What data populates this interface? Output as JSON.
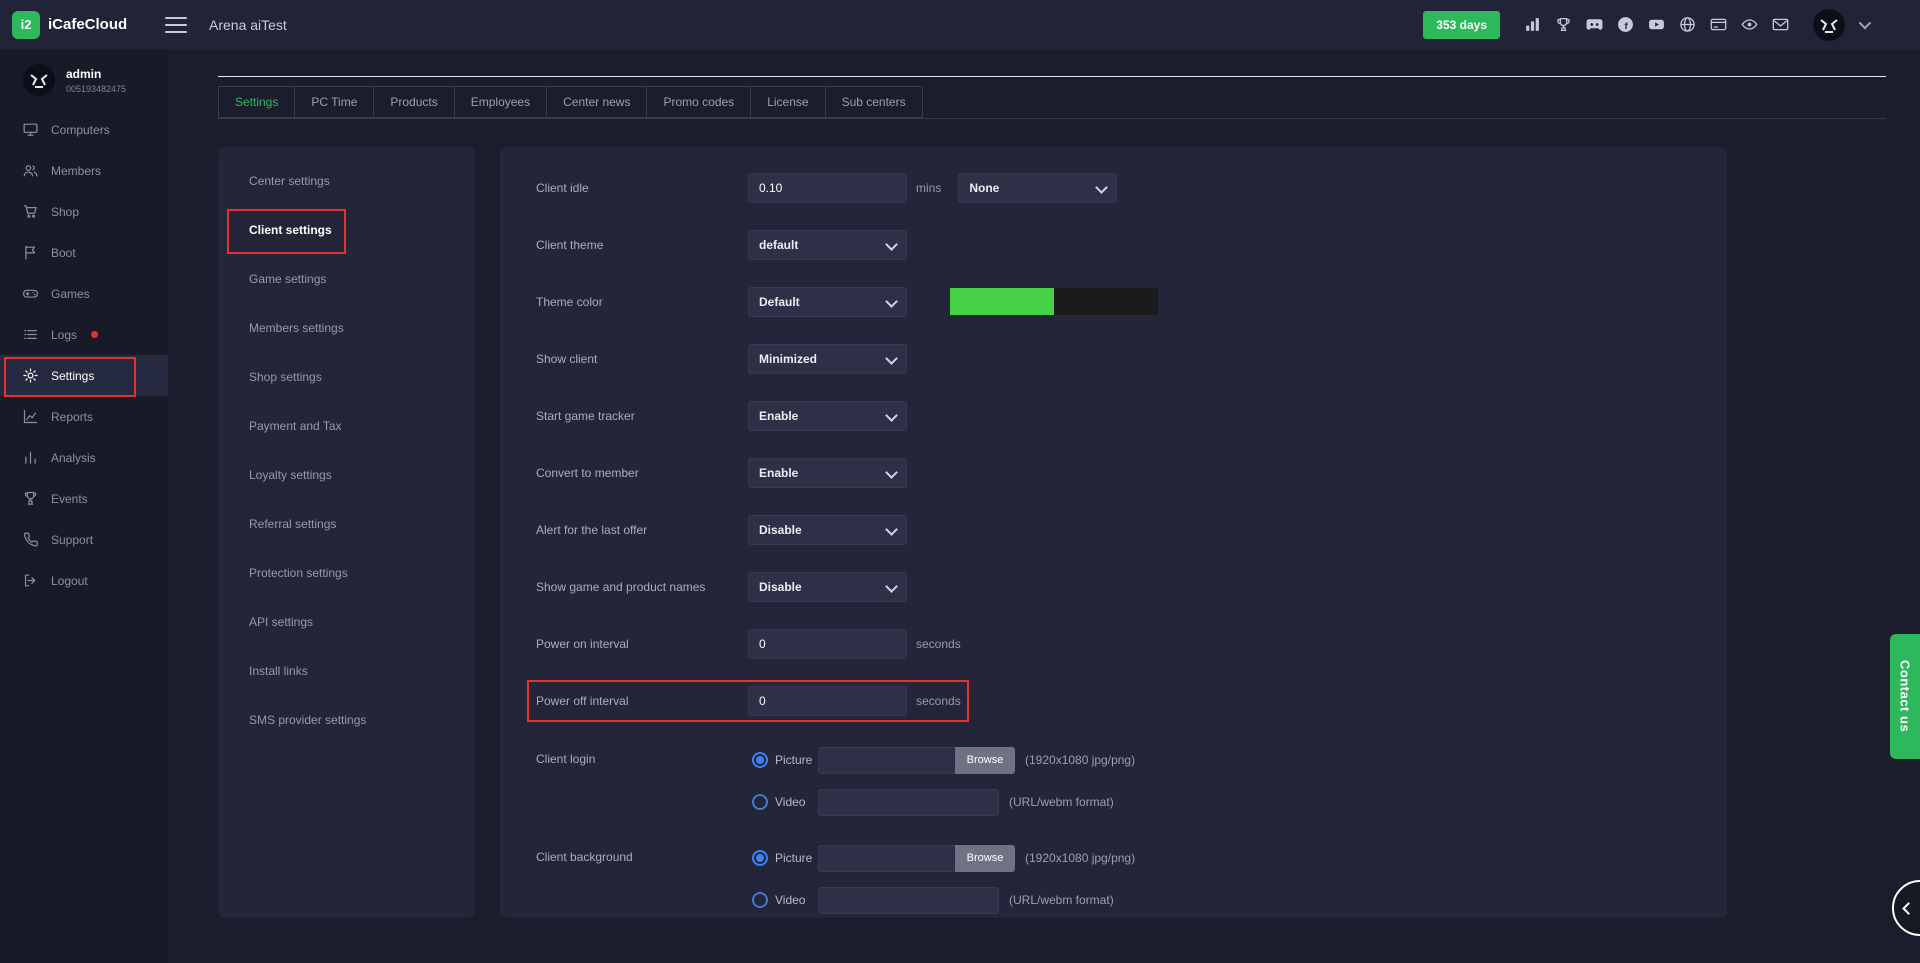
{
  "topbar": {
    "brand": "iCafeCloud",
    "logo_mark": "i2",
    "title": "Arena aiTest",
    "days_badge": "353 days"
  },
  "sidebar": {
    "user_name": "admin",
    "user_id": "005193482475",
    "items": [
      {
        "label": "Computers"
      },
      {
        "label": "Members"
      },
      {
        "label": "Shop"
      },
      {
        "label": "Boot"
      },
      {
        "label": "Games"
      },
      {
        "label": "Logs"
      },
      {
        "label": "Settings"
      },
      {
        "label": "Reports"
      },
      {
        "label": "Analysis"
      },
      {
        "label": "Events"
      },
      {
        "label": "Support"
      },
      {
        "label": "Logout"
      }
    ]
  },
  "tabs": [
    {
      "label": "Settings"
    },
    {
      "label": "PC Time"
    },
    {
      "label": "Products"
    },
    {
      "label": "Employees"
    },
    {
      "label": "Center news"
    },
    {
      "label": "Promo codes"
    },
    {
      "label": "License"
    },
    {
      "label": "Sub centers"
    }
  ],
  "subnav": [
    {
      "label": "Center settings"
    },
    {
      "label": "Client settings"
    },
    {
      "label": "Game settings"
    },
    {
      "label": "Members settings"
    },
    {
      "label": "Shop settings"
    },
    {
      "label": "Payment and Tax"
    },
    {
      "label": "Loyalty settings"
    },
    {
      "label": "Referral settings"
    },
    {
      "label": "Protection settings"
    },
    {
      "label": "API settings"
    },
    {
      "label": "Install links"
    },
    {
      "label": "SMS provider settings"
    }
  ],
  "settings": {
    "client_idle": {
      "label": "Client idle",
      "value": "0.10",
      "unit": "mins",
      "select": "None"
    },
    "client_theme": {
      "label": "Client theme",
      "select": "default"
    },
    "theme_color": {
      "label": "Theme color",
      "select": "Default",
      "swatches": [
        "#46d146",
        "#1b1b1b"
      ]
    },
    "show_client": {
      "label": "Show client",
      "select": "Minimized"
    },
    "start_game_tracker": {
      "label": "Start game tracker",
      "select": "Enable"
    },
    "convert_to_member": {
      "label": "Convert to member",
      "select": "Enable"
    },
    "alert_last_offer": {
      "label": "Alert for the last offer",
      "select": "Disable"
    },
    "show_game_product_names": {
      "label": "Show game and product names",
      "select": "Disable"
    },
    "power_on_interval": {
      "label": "Power on interval",
      "value": "0",
      "unit": "seconds"
    },
    "power_off_interval": {
      "label": "Power off interval",
      "value": "0",
      "unit": "seconds"
    },
    "client_login": {
      "label": "Client login",
      "picture_option": "Picture",
      "picture_value": "",
      "browse_label": "Browse",
      "picture_hint": "(1920x1080 jpg/png)",
      "video_option": "Video",
      "video_value": "",
      "video_hint": "(URL/webm format)"
    },
    "client_background": {
      "label": "Client background",
      "picture_option": "Picture",
      "picture_value": "",
      "browse_label": "Browse",
      "picture_hint": "(1920x1080 jpg/png)",
      "video_option": "Video",
      "video_value": "",
      "video_hint": "(URL/webm format)"
    }
  },
  "contact_us": "Contact us",
  "colors": {
    "accent_green": "#2eb85c",
    "annotation_red": "#e8312d",
    "radio_blue": "#3b82f6",
    "card_bg": "#232539",
    "input_bg": "#2d3046"
  }
}
